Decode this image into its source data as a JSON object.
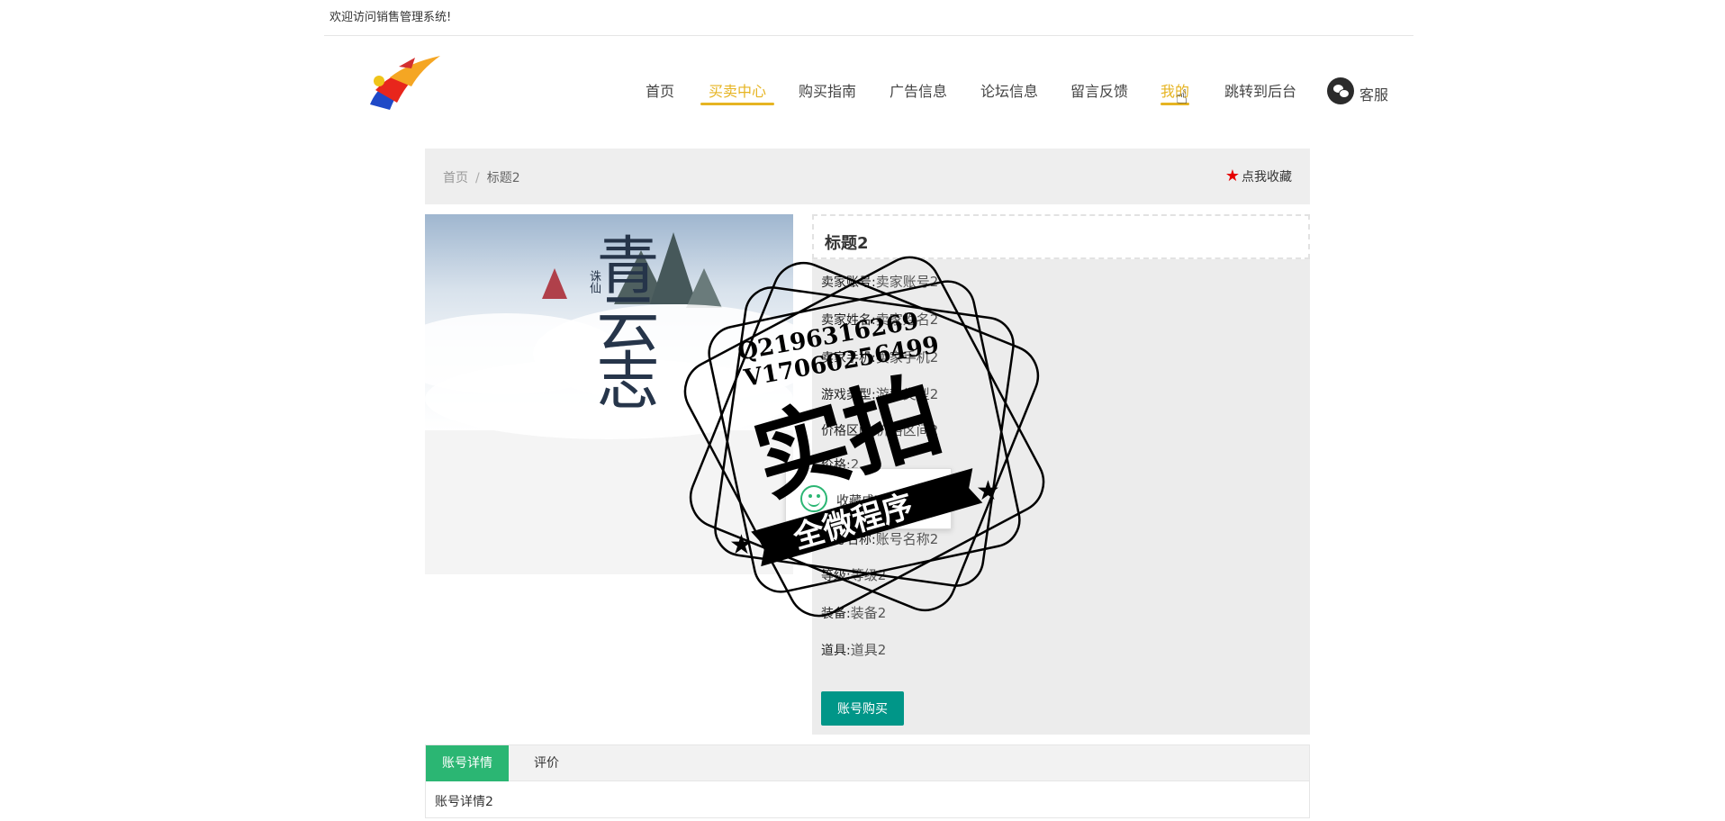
{
  "topbar": {
    "welcome": "欢迎访问销售管理系统!"
  },
  "nav": {
    "items": [
      {
        "label": "首页"
      },
      {
        "label": "买卖中心"
      },
      {
        "label": "购买指南"
      },
      {
        "label": "广告信息"
      },
      {
        "label": "论坛信息"
      },
      {
        "label": "留言反馈"
      },
      {
        "label": "我的"
      },
      {
        "label": "跳转到后台"
      }
    ],
    "active_index": 1,
    "hover_index": 6,
    "kefu_label": "客服"
  },
  "breadcrumb": {
    "home": "首页",
    "separator": "/",
    "current": "标题2"
  },
  "favorite": {
    "label": "点我收藏",
    "icon": "star-icon",
    "color": "#e60000"
  },
  "product": {
    "title": "标题2",
    "fields": [
      {
        "label": "卖家账号:",
        "value": "卖家账号2"
      },
      {
        "label": "卖家姓名:",
        "value": "卖家姓名2"
      },
      {
        "label": "卖家手机:",
        "value": "卖家手机2"
      },
      {
        "label": "游戏类型:",
        "value": "游戏类型2"
      },
      {
        "label": "价格区间:",
        "value": "价格区间2"
      },
      {
        "label": "价格:",
        "value": "2"
      },
      {
        "label": "账号名称:",
        "value": "账号名称2"
      },
      {
        "label": "等级:",
        "value": "等级2"
      },
      {
        "label": "装备:",
        "value": "装备2"
      },
      {
        "label": "道具:",
        "value": "道具2"
      }
    ],
    "buy_label": "账号购买",
    "image_text": "青云志",
    "image_subtext": "诛仙"
  },
  "toast": {
    "message": "收藏成功",
    "icon": "smile-icon",
    "color": "#2bb673"
  },
  "tabs": {
    "items": [
      {
        "label": "账号详情"
      },
      {
        "label": "评价"
      }
    ],
    "active_index": 0,
    "content": "账号详情2"
  },
  "watermark": {
    "line1": "Q2196316269",
    "line2": "V17060256499",
    "main": "实拍",
    "banner": "全微程序"
  },
  "colors": {
    "accent": "#e6b422",
    "primary_button": "#009688",
    "active_tab": "#2bb673"
  }
}
